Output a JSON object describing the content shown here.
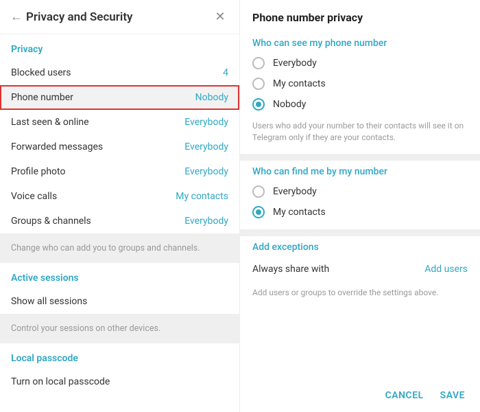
{
  "left": {
    "title": "Privacy and Security",
    "sections": {
      "privacy": {
        "heading": "Privacy",
        "items": [
          {
            "label": "Blocked users",
            "value": "4",
            "isNumber": true
          },
          {
            "label": "Phone number",
            "value": "Nobody",
            "highlighted": true
          },
          {
            "label": "Last seen & online",
            "value": "Everybody"
          },
          {
            "label": "Forwarded messages",
            "value": "Everybody"
          },
          {
            "label": "Profile photo",
            "value": "Everybody"
          },
          {
            "label": "Voice calls",
            "value": "My contacts"
          },
          {
            "label": "Groups & channels",
            "value": "Everybody"
          }
        ],
        "footer": "Change who can add you to groups and channels."
      },
      "sessions": {
        "heading": "Active sessions",
        "items": [
          {
            "label": "Show all sessions",
            "value": ""
          }
        ],
        "footer": "Control your sessions on other devices."
      },
      "passcode": {
        "heading": "Local passcode",
        "items": [
          {
            "label": "Turn on local passcode",
            "value": ""
          }
        ]
      }
    }
  },
  "right": {
    "title": "Phone number privacy",
    "see": {
      "heading": "Who can see my phone number",
      "options": [
        "Everybody",
        "My contacts",
        "Nobody"
      ],
      "selected": "Nobody",
      "hint": "Users who add your number to their contacts will see it on Telegram only if they are your contacts."
    },
    "find": {
      "heading": "Who can find me by my number",
      "options": [
        "Everybody",
        "My contacts"
      ],
      "selected": "My contacts"
    },
    "exceptions": {
      "heading": "Add exceptions",
      "row_label": "Always share with",
      "row_action": "Add users",
      "hint": "Add users or groups to override the settings above."
    },
    "buttons": {
      "cancel": "CANCEL",
      "save": "SAVE"
    }
  }
}
